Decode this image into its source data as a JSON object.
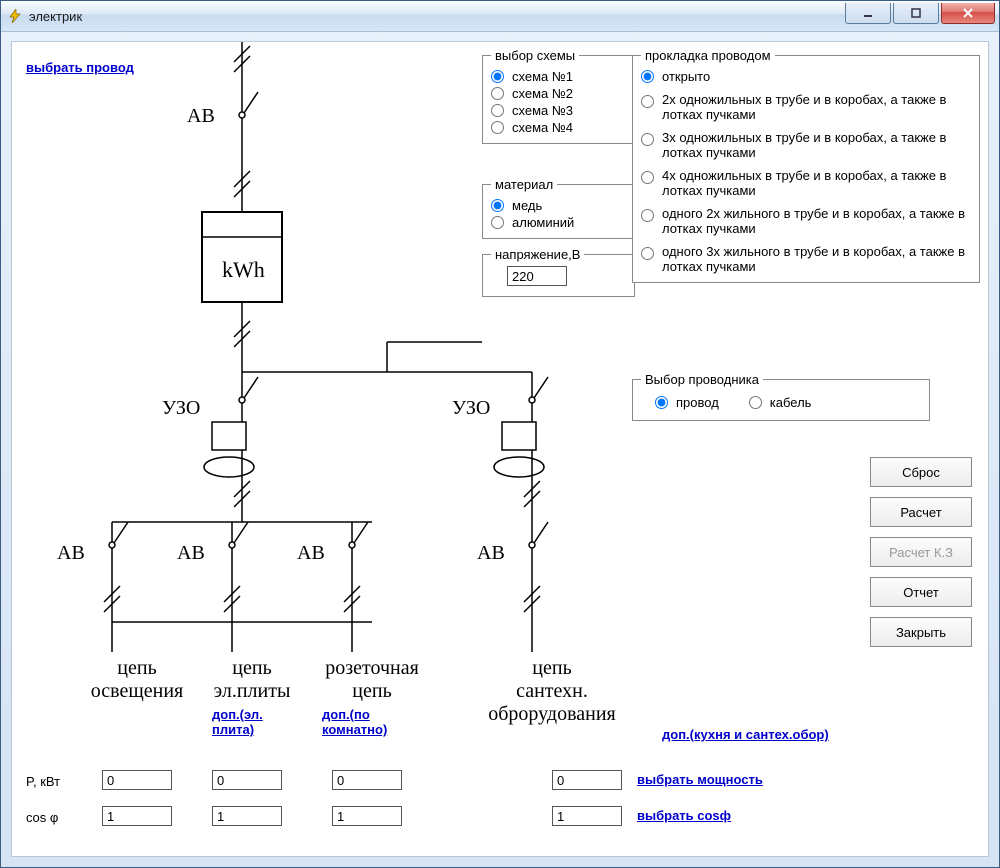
{
  "window": {
    "title": "электрик"
  },
  "links": {
    "select_wire": "выбрать провод",
    "dop_plita": "доп.(эл. плита)",
    "dop_komnatno": "доп.(по комнатно)",
    "dop_kitchen": "доп.(кухня и сантех.обор)",
    "select_power": "выбрать мощность",
    "select_cosf": "выбрать cosф"
  },
  "groups": {
    "scheme": {
      "legend": "выбор схемы",
      "options": [
        "схема №1",
        "схема №2",
        "схема №3",
        "схема №4"
      ],
      "selected": 0
    },
    "material": {
      "legend": "материал",
      "options": [
        "медь",
        "алюминий"
      ],
      "selected": 0
    },
    "voltage": {
      "legend": "напряжение,В",
      "value": "220"
    },
    "wiring": {
      "legend": "прокладка проводом",
      "options": [
        "открыто",
        "2х одножильных в трубе и в коробах, а также в лотках пучками",
        "3х одножильных в трубе и в коробах, а также в лотках пучками",
        "4х одножильных в трубе и в коробах, а также в лотках пучками",
        "одного 2х жильного в трубе и в коробах, а также в лотках пучками",
        "одного 3х жильного в трубе и в коробах, а также в лотках пучками"
      ],
      "selected": 0
    },
    "conductor": {
      "legend": "Выбор проводника",
      "options": [
        "провод",
        "кабель"
      ],
      "selected": 0
    }
  },
  "buttons": {
    "reset": "Сброс",
    "calc": "Расчет",
    "calc_kz": "Расчет К.З",
    "report": "Отчет",
    "close": "Закрыть"
  },
  "diagram": {
    "av": "АВ",
    "kwh": "kWh",
    "uzo": "УЗО",
    "circuit_lighting_1": "цепь",
    "circuit_lighting_2": "освещения",
    "circuit_stove_1": "цепь",
    "circuit_stove_2": "эл.плиты",
    "circuit_outlet_1": "розеточная",
    "circuit_outlet_2": "цепь",
    "circuit_plumbing_1": "цепь",
    "circuit_plumbing_2": "сантехн.",
    "circuit_plumbing_3": "оброрудования"
  },
  "bottom": {
    "power_label": "P, кВт",
    "cosf_label": "cos φ",
    "p1": "0",
    "p2": "0",
    "p3": "0",
    "p4": "0",
    "c1": "1",
    "c2": "1",
    "c3": "1",
    "c4": "1"
  }
}
